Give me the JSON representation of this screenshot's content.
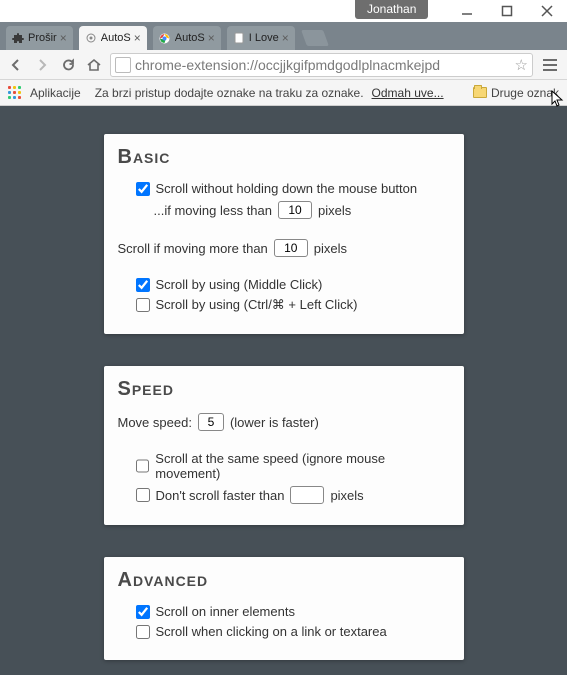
{
  "window": {
    "user": "Jonathan"
  },
  "tabs": [
    {
      "label": "Prošir"
    },
    {
      "label": "AutoS"
    },
    {
      "label": "AutoS"
    },
    {
      "label": "I Love"
    }
  ],
  "toolbar": {
    "url": "chrome-extension://occjjkgifpmdgodlplnacmkejpd"
  },
  "bookmarks": {
    "apps_label": "Aplikacije",
    "hint": "Za brzi pristup dodajte oznake na traku za oznake.",
    "hint_link": "Odmah uve...",
    "other": "Druge oznak"
  },
  "basic": {
    "title": "Basic",
    "opt1": "Scroll without holding down the mouse button",
    "opt1_sub_pre": "...if moving less than",
    "opt1_sub_val": "10",
    "opt1_sub_post": "pixels",
    "line2_pre": "Scroll if moving more than",
    "line2_val": "10",
    "line2_post": "pixels",
    "opt2": "Scroll by using (Middle Click)",
    "opt3": "Scroll by using (Ctrl/⌘ + Left Click)"
  },
  "speed": {
    "title": "Speed",
    "move_pre": "Move speed:",
    "move_val": "5",
    "move_post": "(lower is faster)",
    "opt1": "Scroll at the same speed (ignore mouse movement)",
    "opt2_pre": "Don't scroll faster than",
    "opt2_val": "",
    "opt2_post": "pixels"
  },
  "advanced": {
    "title": "Advanced",
    "opt1": "Scroll on inner elements",
    "opt2": "Scroll when clicking on a link or textarea"
  }
}
